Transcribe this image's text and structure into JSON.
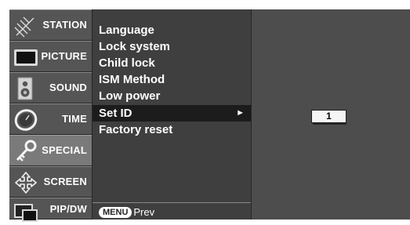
{
  "tabs": [
    {
      "label": "STATION",
      "icon": "antenna-icon",
      "selected": false
    },
    {
      "label": "PICTURE",
      "icon": "monitor-icon",
      "selected": false
    },
    {
      "label": "SOUND",
      "icon": "speaker-icon",
      "selected": false
    },
    {
      "label": "TIME",
      "icon": "clock-icon",
      "selected": false
    },
    {
      "label": "SPECIAL",
      "icon": "key-icon",
      "selected": true
    },
    {
      "label": "SCREEN",
      "icon": "move-arrows-icon",
      "selected": false
    },
    {
      "label": "PIP/DW",
      "icon": "pip-icon",
      "selected": false
    }
  ],
  "menu": {
    "items": [
      {
        "label": "Language",
        "selected": false
      },
      {
        "label": "Lock system",
        "selected": false
      },
      {
        "label": "Child lock",
        "selected": false
      },
      {
        "label": "ISM Method",
        "selected": false
      },
      {
        "label": "Low power",
        "selected": false
      },
      {
        "label": "Set ID",
        "selected": true,
        "arrow": "►"
      },
      {
        "label": "Factory reset",
        "selected": false
      }
    ],
    "footer": {
      "key": "MENU",
      "label": "Prev"
    }
  },
  "value_panel": {
    "set_id_value": "1"
  },
  "colors": {
    "background": "#4d4d4d",
    "menu_panel": "#3f3f3f",
    "selected_row": "#1c1c1c",
    "selected_tab": "#7a7a7a",
    "text": "#ffffff"
  }
}
